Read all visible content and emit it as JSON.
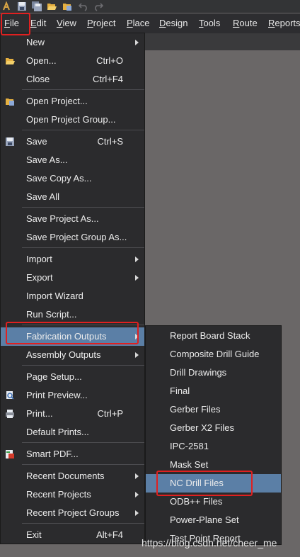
{
  "menubar": {
    "items": [
      "File",
      "Edit",
      "View",
      "Project",
      "Place",
      "Design",
      "Tools",
      "Route",
      "Reports"
    ]
  },
  "file_menu": {
    "new": {
      "label": "New"
    },
    "open": {
      "label": "Open...",
      "shortcut": "Ctrl+O"
    },
    "close": {
      "label": "Close",
      "shortcut": "Ctrl+F4"
    },
    "open_project": {
      "label": "Open Project..."
    },
    "open_project_group": {
      "label": "Open Project Group..."
    },
    "save": {
      "label": "Save",
      "shortcut": "Ctrl+S"
    },
    "save_as": {
      "label": "Save As..."
    },
    "save_copy_as": {
      "label": "Save Copy As..."
    },
    "save_all": {
      "label": "Save All"
    },
    "save_project_as": {
      "label": "Save Project As..."
    },
    "save_project_group_as": {
      "label": "Save Project Group As..."
    },
    "import": {
      "label": "Import"
    },
    "export": {
      "label": "Export"
    },
    "import_wizard": {
      "label": "Import Wizard"
    },
    "run_script": {
      "label": "Run Script..."
    },
    "fabrication_outputs": {
      "label": "Fabrication Outputs"
    },
    "assembly_outputs": {
      "label": "Assembly Outputs"
    },
    "page_setup": {
      "label": "Page Setup..."
    },
    "print_preview": {
      "label": "Print Preview..."
    },
    "print": {
      "label": "Print...",
      "shortcut": "Ctrl+P"
    },
    "default_prints": {
      "label": "Default Prints..."
    },
    "smart_pdf": {
      "label": "Smart PDF..."
    },
    "recent_documents": {
      "label": "Recent Documents"
    },
    "recent_projects": {
      "label": "Recent Projects"
    },
    "recent_project_groups": {
      "label": "Recent Project Groups"
    },
    "exit": {
      "label": "Exit",
      "shortcut": "Alt+F4"
    }
  },
  "fabrication_submenu": {
    "items": [
      "Report Board Stack",
      "Composite Drill Guide",
      "Drill Drawings",
      "Final",
      "Gerber Files",
      "Gerber X2 Files",
      "IPC-2581",
      "Mask Set",
      "NC Drill Files",
      "ODB++ Files",
      "Power-Plane Set",
      "Test Point Report"
    ],
    "highlighted": "NC Drill Files"
  },
  "watermark": "https://blog.csdn.net/cheer_me",
  "colors": {
    "menu_bg": "#2b2b2d",
    "highlight": "#5b7fa6",
    "annotation_red": "#e02020",
    "workspace": "#6a6767"
  }
}
